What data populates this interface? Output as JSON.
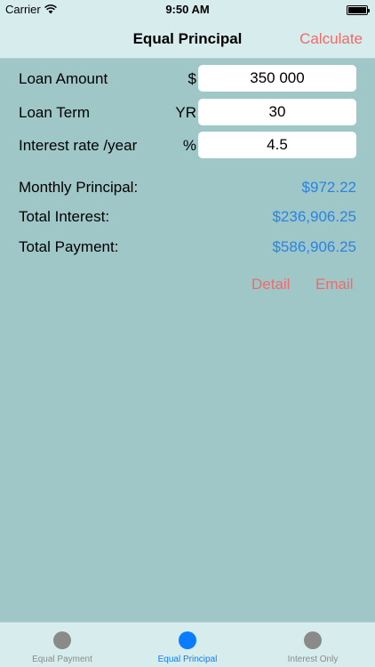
{
  "status_bar": {
    "carrier": "Carrier",
    "time": "9:50 AM"
  },
  "nav": {
    "title": "Equal Principal",
    "action_label": "Calculate"
  },
  "form": {
    "loan_amount": {
      "label": "Loan Amount",
      "unit": "$",
      "value": "350 000"
    },
    "loan_term": {
      "label": "Loan Term",
      "unit": "YR",
      "value": "30"
    },
    "interest_rate": {
      "label": "Interest rate /year",
      "unit": "%",
      "value": "4.5"
    }
  },
  "results": {
    "monthly_principal": {
      "label": "Monthly Principal:",
      "value": "$972.22"
    },
    "total_interest": {
      "label": "Total Interest:",
      "value": "$236,906.25"
    },
    "total_payment": {
      "label": "Total Payment:",
      "value": "$586,906.25"
    }
  },
  "actions": {
    "detail_label": "Detail",
    "email_label": "Email"
  },
  "tabs": [
    {
      "label": "Equal Payment",
      "active": false
    },
    {
      "label": "Equal Principal",
      "active": true
    },
    {
      "label": "Interest Only",
      "active": false
    }
  ],
  "colors": {
    "background": "#9fc7c7",
    "bar_background": "#d7eded",
    "accent_red": "#f06a6a",
    "value_blue": "#2a84e0",
    "tab_active": "#0a7cff",
    "tab_inactive": "#8a8a8a"
  },
  "icons": {
    "wifi": "wifi-icon",
    "battery": "battery-icon",
    "tab": "circle-icon"
  }
}
